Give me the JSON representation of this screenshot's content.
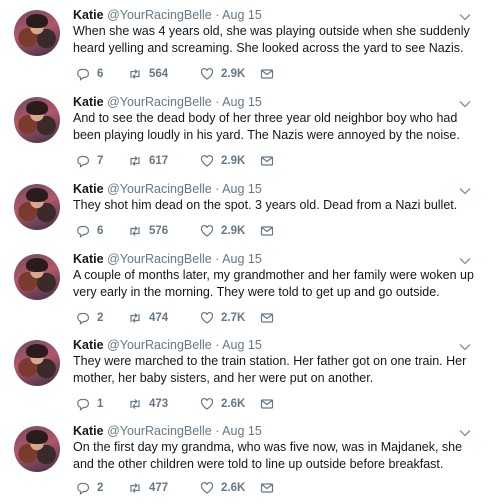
{
  "tweets": [
    {
      "name": "Katie",
      "handle": "@YourRacingBelle",
      "date": "Aug 15",
      "text": "When she was 4 years old, she was playing outside when she suddenly heard yelling and screaming. She looked across the yard to see Nazis.",
      "replies": "6",
      "retweets": "564",
      "likes": "2.9K"
    },
    {
      "name": "Katie",
      "handle": "@YourRacingBelle",
      "date": "Aug 15",
      "text": "And to see the dead body of her three year old neighbor boy who had been playing loudly in his yard. The Nazis were annoyed by the noise.",
      "replies": "7",
      "retweets": "617",
      "likes": "2.9K"
    },
    {
      "name": "Katie",
      "handle": "@YourRacingBelle",
      "date": "Aug 15",
      "text": "They shot him dead on the spot. 3 years old. Dead from a Nazi bullet.",
      "replies": "6",
      "retweets": "576",
      "likes": "2.9K"
    },
    {
      "name": "Katie",
      "handle": "@YourRacingBelle",
      "date": "Aug 15",
      "text": "A couple of months later, my grandmother and her family were woken up very early in the morning. They were told to get up and go outside.",
      "replies": "2",
      "retweets": "474",
      "likes": "2.7K"
    },
    {
      "name": "Katie",
      "handle": "@YourRacingBelle",
      "date": "Aug 15",
      "text": "They were marched to the train station. Her father got on one train. Her mother, her baby sisters, and her were put on another.",
      "replies": "1",
      "retweets": "473",
      "likes": "2.6K"
    },
    {
      "name": "Katie",
      "handle": "@YourRacingBelle",
      "date": "Aug 15",
      "text": "On the first day my grandma, who was five now, was in Majdanek, she and the other children were told to line up outside before breakfast.",
      "replies": "2",
      "retweets": "477",
      "likes": "2.6K"
    }
  ],
  "icons": {
    "reply": "reply-icon",
    "retweet": "retweet-icon",
    "like": "heart-icon",
    "dm": "envelope-icon",
    "more": "chevron-down-icon"
  },
  "colors": {
    "text": "#14171a",
    "secondary": "#657786",
    "background": "#ffffff"
  }
}
